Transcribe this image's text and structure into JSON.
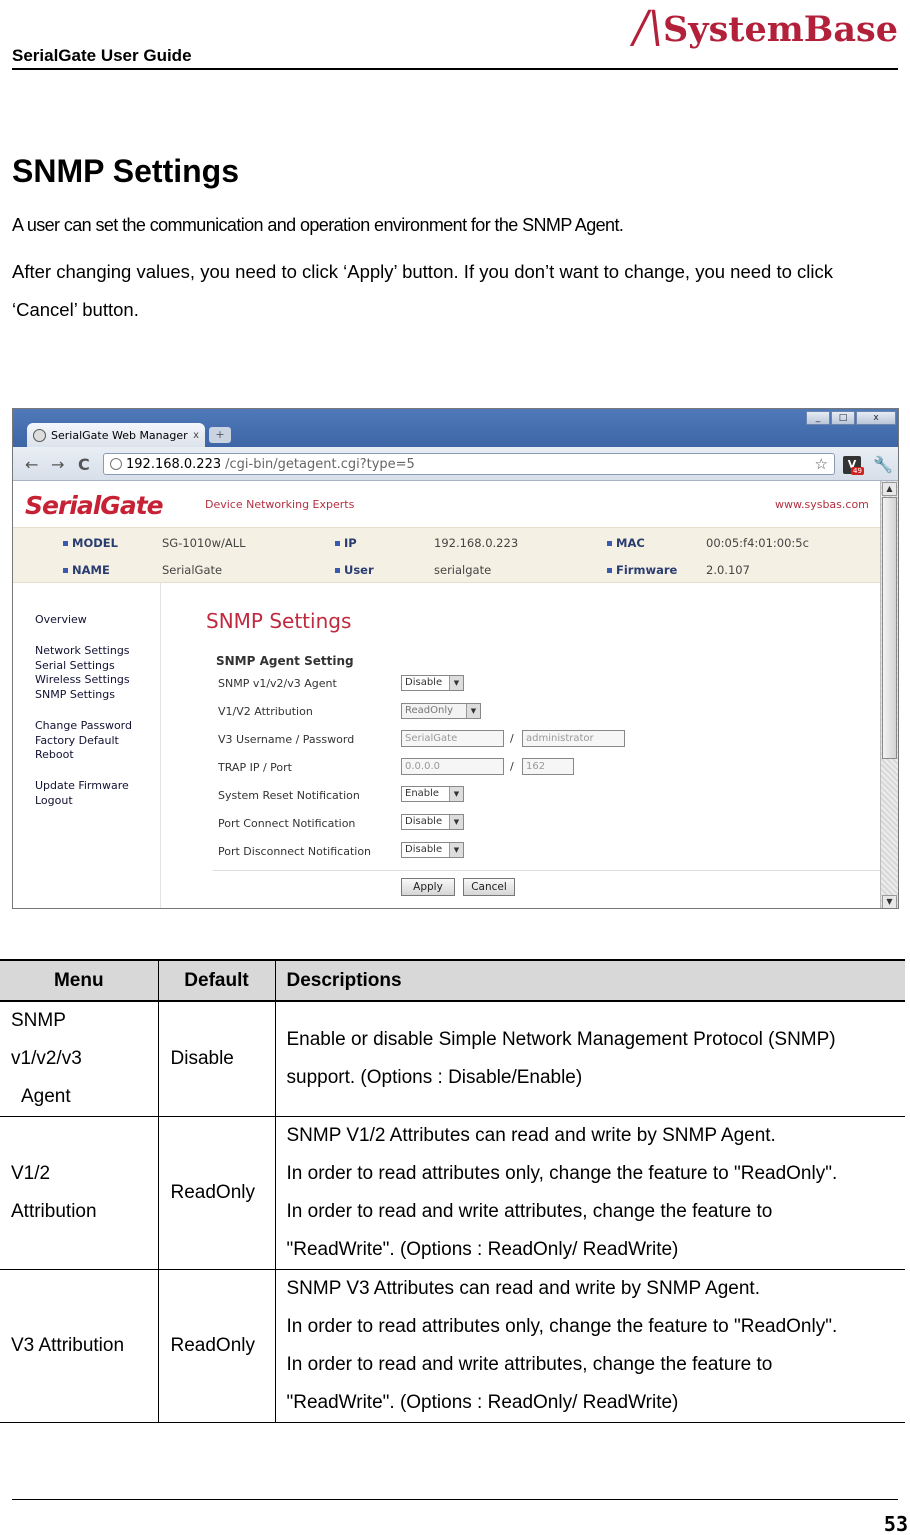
{
  "header": {
    "doc_title": "SerialGate User Guide",
    "brand_mark": "/\\",
    "brand_word": "SystemBase"
  },
  "section": {
    "title": "SNMP Settings",
    "intro_line1": "A user can set the communication and operation environment for the SNMP Agent.",
    "intro_line2": "After changing values, you need to click ‘Apply’ button. If you don’t want to change, you need to click ‘Cancel’ button."
  },
  "browser": {
    "tab_title": "SerialGate Web Manager",
    "tab_close": "x",
    "new_tab": "+",
    "window_buttons": [
      "_",
      "□",
      "x"
    ],
    "nav": {
      "back": "←",
      "forward": "→",
      "reload": "C"
    },
    "url_host": "192.168.0.223",
    "url_path": "/cgi-bin/getagent.cgi?type=5",
    "ext_label": "V",
    "ext_badge": "49"
  },
  "webapp": {
    "logo": "SerialGate",
    "tagline": "Device Networking Experts",
    "site_url": "www.sysbas.com",
    "info": {
      "model_label": "MODEL",
      "model_value": "SG-1010w/ALL",
      "ip_label": "IP",
      "ip_value": "192.168.0.223",
      "mac_label": "MAC",
      "mac_value": "00:05:f4:01:00:5c",
      "name_label": "NAME",
      "name_value": "SerialGate",
      "user_label": "User",
      "user_value": "serialgate",
      "firmware_label": "Firmware",
      "firmware_value": "2.0.107"
    },
    "menu": [
      "Overview",
      "Network Settings",
      "Serial Settings",
      "Wireless Settings",
      "SNMP Settings",
      "Change Password",
      "Factory Default",
      "Reboot",
      "Update Firmware",
      "Logout"
    ],
    "panel_title": "SNMP Settings",
    "panel_subtitle": "SNMP Agent Setting",
    "fields": {
      "agent_label": "SNMP v1/v2/v3 Agent",
      "agent_value": "Disable",
      "v12_label": "V1/V2 Attribution",
      "v12_value": "ReadOnly",
      "v3_label": "V3 Username / Password",
      "v3_user": "SerialGate",
      "v3_pass": "administrator",
      "trap_label": "TRAP IP / Port",
      "trap_ip": "0.0.0.0",
      "trap_port": "162",
      "reset_label": "System Reset Notification",
      "reset_value": "Enable",
      "connect_label": "Port Connect Notification",
      "connect_value": "Disable",
      "disconnect_label": "Port Disconnect Notification",
      "disconnect_value": "Disable",
      "slash": "/"
    },
    "apply_label": "Apply",
    "cancel_label": "Cancel"
  },
  "table": {
    "headers": [
      "Menu",
      "Default",
      "Descriptions"
    ],
    "rows": [
      {
        "menu": [
          "SNMP",
          "v1/v2/v3",
          "Agent"
        ],
        "default": "Disable",
        "desc": [
          "Enable or disable Simple Network Management Protocol (SNMP)",
          "support. (Options : Disable/Enable)"
        ]
      },
      {
        "menu": [
          "V1/2",
          "Attribution"
        ],
        "default": "ReadOnly",
        "desc": [
          "SNMP V1/2 Attributes can read and write by SNMP Agent.",
          "In order to read attributes only, change the feature to \"ReadOnly\".",
          "In order to read and write attributes, change the feature to",
          "\"ReadWrite\". (Options : ReadOnly/ ReadWrite)"
        ]
      },
      {
        "menu": [
          "V3 Attribution"
        ],
        "default": "ReadOnly",
        "desc": [
          "SNMP V3 Attributes can read and write by SNMP Agent.",
          "In order to read attributes only, change the feature to \"ReadOnly\".",
          "In order to read and write attributes, change the feature to",
          "\"ReadWrite\". (Options : ReadOnly/ ReadWrite)"
        ]
      }
    ]
  },
  "footer": {
    "page_number": "53"
  }
}
